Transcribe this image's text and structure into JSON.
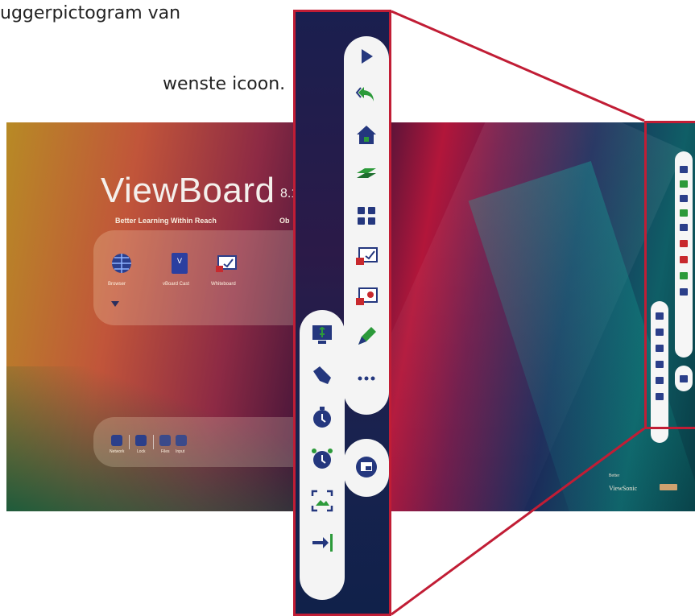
{
  "instructions": {
    "line1": "uggerpictogram van",
    "line2": "wenste icoon."
  },
  "screen": {
    "title": "ViewBoard",
    "version": "8.1",
    "subtitle": "Better Learning Within Reach",
    "subtitle_cut": "Ob",
    "apps": [
      {
        "label": "Browser",
        "icon": "globe-icon"
      },
      {
        "label": "vBoard Cast",
        "icon": "vboard-icon"
      },
      {
        "label": "Whiteboard",
        "icon": "whiteboard-icon"
      }
    ],
    "bottom_labels": [
      "Network",
      "Lock",
      "Files",
      "Input"
    ],
    "brand": "ViewSonic",
    "brand_tiny": "Better"
  },
  "toolbar_main": [
    {
      "name": "play-icon",
      "color": "#24377e"
    },
    {
      "name": "back-icon",
      "color": "#2c9a3a"
    },
    {
      "name": "home-icon",
      "color": "#24377e"
    },
    {
      "name": "layers-icon",
      "color": "#2c9a3a"
    },
    {
      "name": "apps-grid-icon",
      "color": "#24377e"
    },
    {
      "name": "whiteboard-icon",
      "color": "#c8292e"
    },
    {
      "name": "screen-record-icon",
      "color": "#c8292e"
    },
    {
      "name": "marker-icon",
      "color": "#2c9a3a"
    },
    {
      "name": "more-icon",
      "color": "#24377e"
    }
  ],
  "toolbar_side": [
    {
      "name": "monitor-icon",
      "color": "#24377e"
    },
    {
      "name": "flashlight-icon",
      "color": "#24377e"
    },
    {
      "name": "timer-icon",
      "color": "#24377e"
    },
    {
      "name": "alarm-clock-icon",
      "color": "#24377e"
    },
    {
      "name": "screenshot-icon",
      "color": "#24377e"
    },
    {
      "name": "exit-icon",
      "color": "#24377e"
    }
  ],
  "toolbar_extra": {
    "name": "floating-window-icon",
    "color": "#24377e"
  },
  "colors": {
    "callout_border": "#c11d35",
    "pill": "#f4f4f4"
  }
}
